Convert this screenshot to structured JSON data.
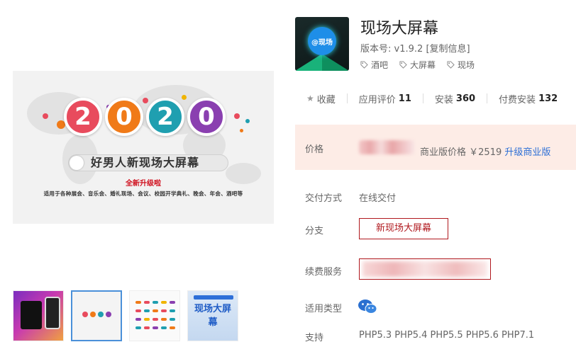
{
  "product": {
    "title": "现场大屏幕",
    "version_label": "版本号:",
    "version": "v1.9.2",
    "copy_info": "[复制信息]",
    "icon_text": "@现场",
    "tags": [
      "酒吧",
      "大屏幕",
      "现场"
    ]
  },
  "stats": {
    "favorite_label": "收藏",
    "rating_label": "应用评价",
    "rating_value": "11",
    "install_label": "安装",
    "install_value": "360",
    "paid_install_label": "付费安装",
    "paid_install_value": "132"
  },
  "price": {
    "label": "价格",
    "business_price_label": "商业版价格",
    "business_price_value": "￥2519",
    "upgrade_link": "升级商业版"
  },
  "details": {
    "delivery_label": "交付方式",
    "delivery_value": "在线交付",
    "branch_label": "分支",
    "branch_value": "新现场大屏幕",
    "renew_label": "续费服务",
    "type_label": "适用类型",
    "support_label": "支持",
    "support_value": "PHP5.3 PHP5.4 PHP5.5 PHP5.6 PHP7.1"
  },
  "banner": {
    "year_digits": [
      "2",
      "0",
      "2",
      "0"
    ],
    "slogan": "好男人新现场大屏幕",
    "promo": "全新升级啦",
    "description": "适用于各种展会、音乐会、婚礼现场、会议、校园开学典礼、晚会、年会、酒吧等"
  },
  "thumbnails": {
    "t4_title": "现场大屏幕"
  },
  "colors": {
    "accent_red": "#b0181e",
    "link_blue": "#2d6fd6",
    "price_bg": "#fdece6",
    "digit_colors": [
      "#e84b5d",
      "#f07a18",
      "#1f9fb0",
      "#8a3fb0"
    ]
  },
  "icons": [
    "star-icon",
    "tag-icon",
    "wechat-icon"
  ]
}
